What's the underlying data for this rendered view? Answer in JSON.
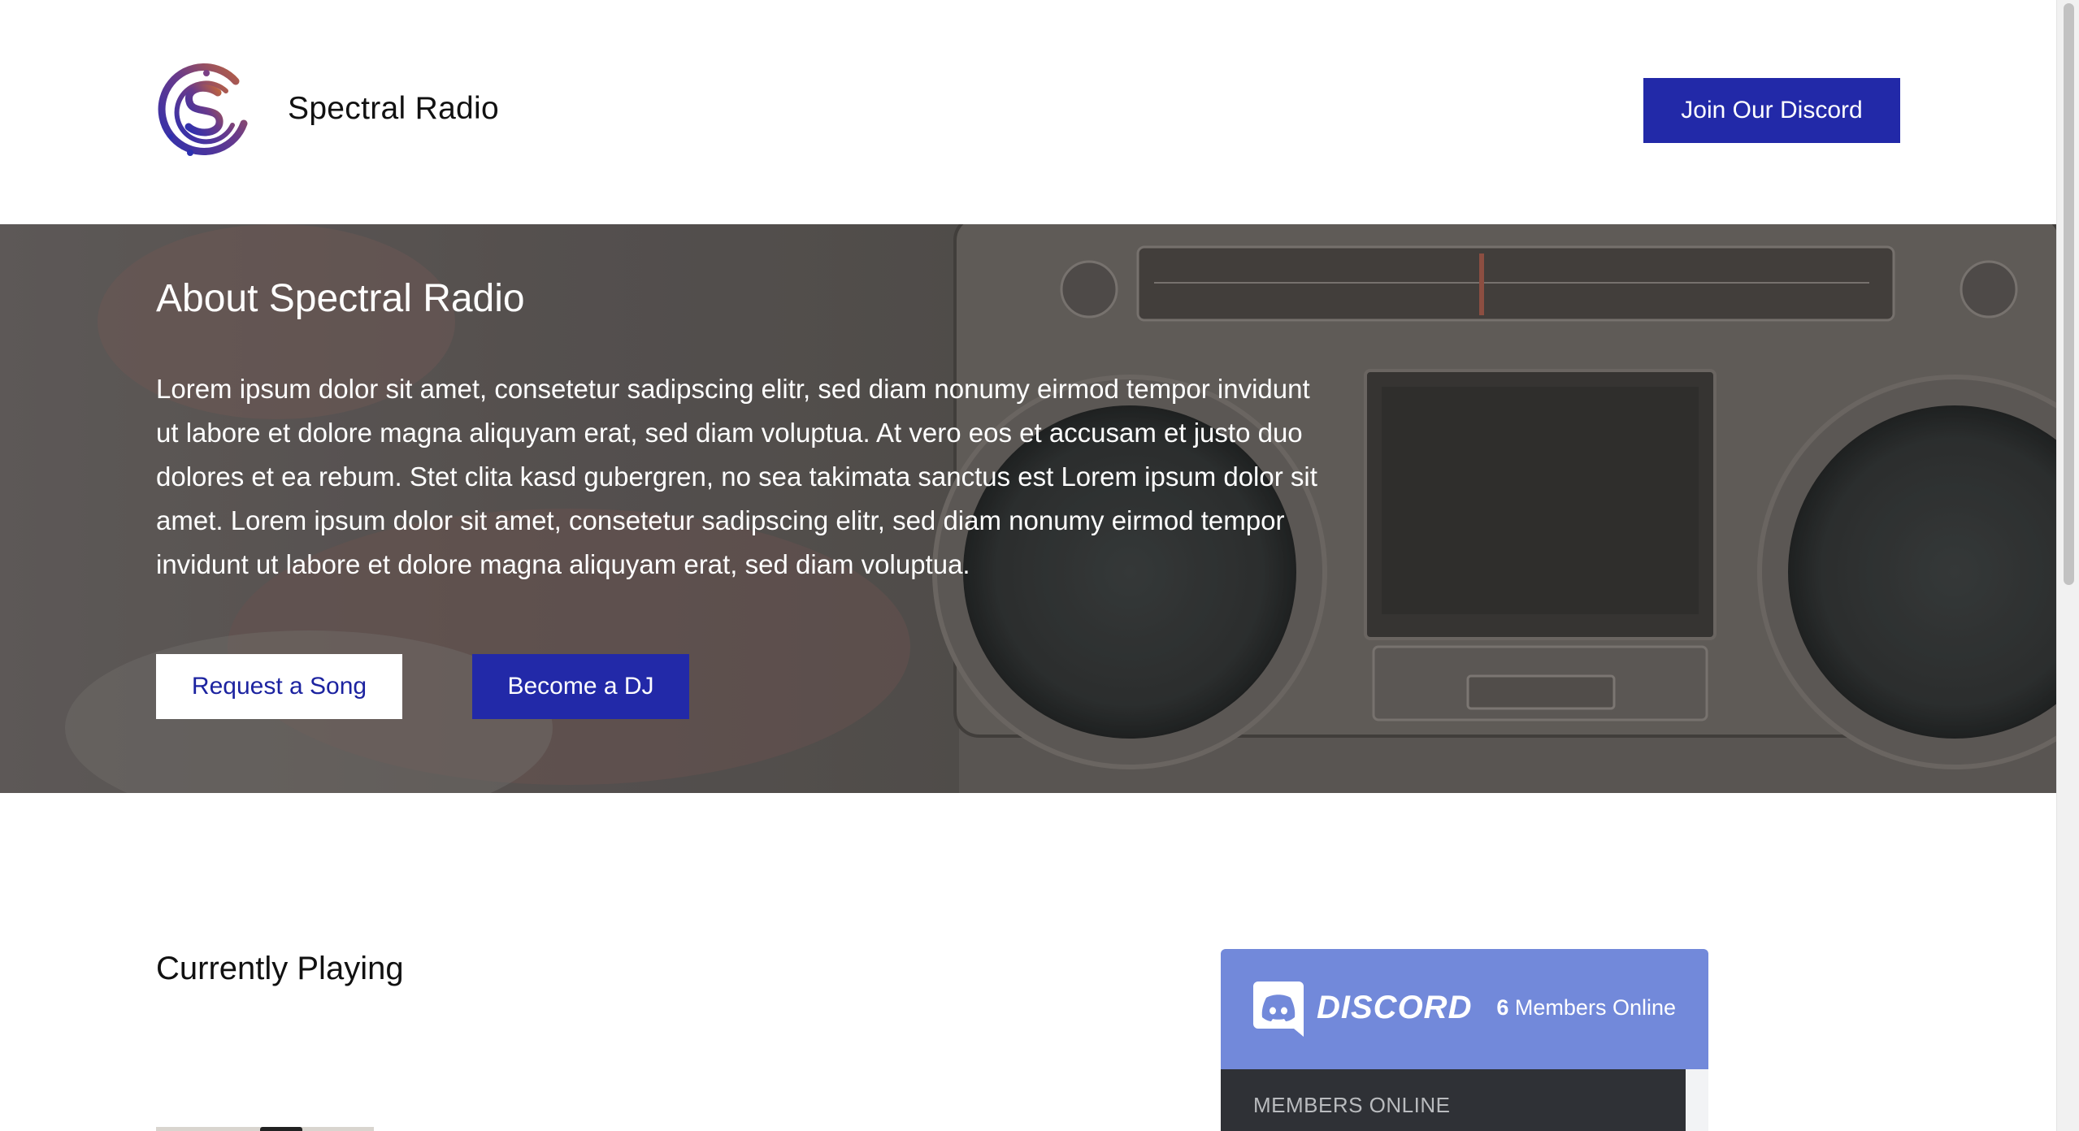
{
  "header": {
    "brand_name": "Spectral Radio",
    "join_discord_label": "Join Our Discord",
    "logo_icon": "spectral-radio-logo-icon"
  },
  "hero": {
    "title": "About Spectral Radio",
    "paragraph": "Lorem ipsum dolor sit amet, consetetur sadipscing elitr, sed diam nonumy eirmod tempor invidunt ut labore et dolore magna aliquyam erat, sed diam voluptua. At vero eos et accusam et justo duo dolores et ea rebum. Stet clita kasd gubergren, no sea takimata sanctus est Lorem ipsum dolor sit amet. Lorem ipsum dolor sit amet, consetetur sadipscing elitr, sed diam nonumy eirmod tempor invidunt ut labore et dolore magna aliquyam erat, sed diam voluptua.",
    "request_song_label": "Request a Song",
    "become_dj_label": "Become a DJ",
    "background": "boombox-radio-photo"
  },
  "currently_playing": {
    "title": "Currently Playing"
  },
  "discord_widget": {
    "brand": "DISCORD",
    "members_count": "6",
    "members_suffix": "Members Online",
    "members_online_label": "MEMBERS ONLINE",
    "header_color": "#7289da",
    "body_color": "#2f3136"
  },
  "colors": {
    "accent": "#2229a8",
    "hero_overlay": "#5f5e5b"
  }
}
